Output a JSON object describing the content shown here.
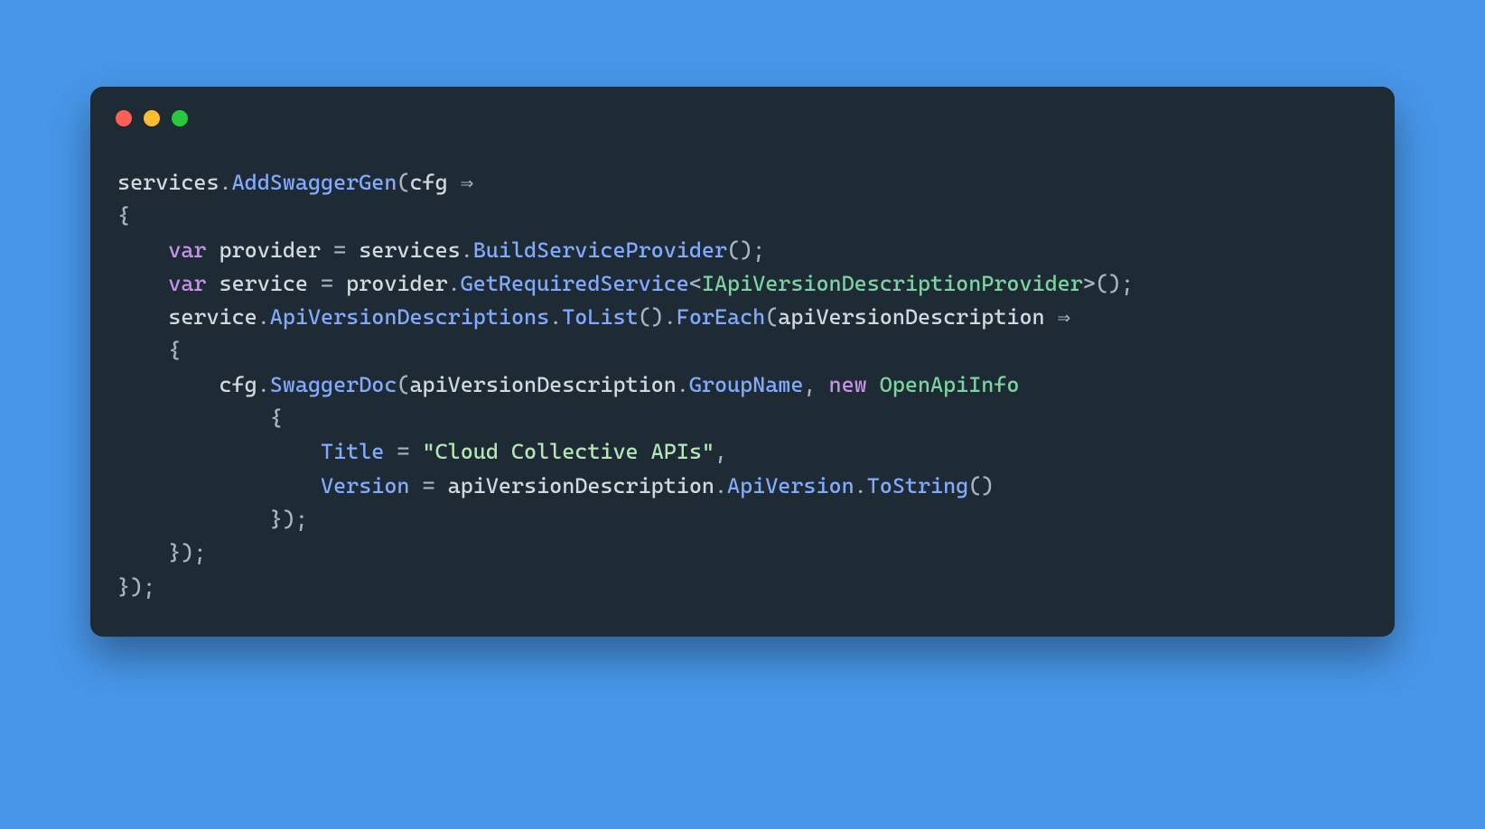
{
  "colors": {
    "background": "#4896e9",
    "card": "#1e2b34",
    "traffic_red": "#ff5f57",
    "traffic_yellow": "#febc2e",
    "traffic_green": "#28c840",
    "token_default": "#d2d9e1",
    "token_punct": "#a9b5c2",
    "token_method": "#82aaff",
    "token_type": "#7dd3a1",
    "token_keyword": "#c792ea",
    "token_string": "#b5e6b5"
  },
  "traffic_lights": [
    "red",
    "yellow",
    "green"
  ],
  "code": {
    "language": "csharp",
    "indent": "    ",
    "arrow": "⇒",
    "lines": [
      [
        {
          "cls": "tk-default",
          "t": "services"
        },
        {
          "cls": "tk-punct",
          "t": "."
        },
        {
          "cls": "tk-method",
          "t": "AddSwaggerGen"
        },
        {
          "cls": "tk-punct",
          "t": "("
        },
        {
          "cls": "tk-default",
          "t": "cfg "
        },
        {
          "cls": "tk-punct",
          "t": "⇒"
        }
      ],
      [
        {
          "cls": "tk-punct",
          "t": "{"
        }
      ],
      [
        {
          "cls": "tk-default",
          "t": "    "
        },
        {
          "cls": "tk-keyword",
          "t": "var"
        },
        {
          "cls": "tk-default",
          "t": " provider "
        },
        {
          "cls": "tk-punct",
          "t": "= "
        },
        {
          "cls": "tk-default",
          "t": "services"
        },
        {
          "cls": "tk-punct",
          "t": "."
        },
        {
          "cls": "tk-method",
          "t": "BuildServiceProvider"
        },
        {
          "cls": "tk-punct",
          "t": "();"
        }
      ],
      [
        {
          "cls": "tk-default",
          "t": "    "
        },
        {
          "cls": "tk-keyword",
          "t": "var"
        },
        {
          "cls": "tk-default",
          "t": " service "
        },
        {
          "cls": "tk-punct",
          "t": "= "
        },
        {
          "cls": "tk-default",
          "t": "provider"
        },
        {
          "cls": "tk-punct",
          "t": "."
        },
        {
          "cls": "tk-method",
          "t": "GetRequiredService"
        },
        {
          "cls": "tk-punct",
          "t": "<"
        },
        {
          "cls": "tk-type",
          "t": "IApiVersionDescriptionProvider"
        },
        {
          "cls": "tk-punct",
          "t": ">();"
        }
      ],
      [
        {
          "cls": "tk-default",
          "t": "    service"
        },
        {
          "cls": "tk-punct",
          "t": "."
        },
        {
          "cls": "tk-method",
          "t": "ApiVersionDescriptions"
        },
        {
          "cls": "tk-punct",
          "t": "."
        },
        {
          "cls": "tk-method",
          "t": "ToList"
        },
        {
          "cls": "tk-punct",
          "t": "()."
        },
        {
          "cls": "tk-method",
          "t": "ForEach"
        },
        {
          "cls": "tk-punct",
          "t": "("
        },
        {
          "cls": "tk-default",
          "t": "apiVersionDescription "
        },
        {
          "cls": "tk-punct",
          "t": "⇒"
        }
      ],
      [
        {
          "cls": "tk-default",
          "t": "    "
        },
        {
          "cls": "tk-punct",
          "t": "{"
        }
      ],
      [
        {
          "cls": "tk-default",
          "t": "        cfg"
        },
        {
          "cls": "tk-punct",
          "t": "."
        },
        {
          "cls": "tk-method",
          "t": "SwaggerDoc"
        },
        {
          "cls": "tk-punct",
          "t": "("
        },
        {
          "cls": "tk-default",
          "t": "apiVersionDescription"
        },
        {
          "cls": "tk-punct",
          "t": "."
        },
        {
          "cls": "tk-method",
          "t": "GroupName"
        },
        {
          "cls": "tk-punct",
          "t": ", "
        },
        {
          "cls": "tk-keyword",
          "t": "new"
        },
        {
          "cls": "tk-default",
          "t": " "
        },
        {
          "cls": "tk-type",
          "t": "OpenApiInfo"
        }
      ],
      [
        {
          "cls": "tk-default",
          "t": "            "
        },
        {
          "cls": "tk-punct",
          "t": "{"
        }
      ],
      [
        {
          "cls": "tk-default",
          "t": "                "
        },
        {
          "cls": "tk-method",
          "t": "Title"
        },
        {
          "cls": "tk-default",
          "t": " "
        },
        {
          "cls": "tk-punct",
          "t": "= "
        },
        {
          "cls": "tk-string",
          "t": "\"Cloud Collective APIs\""
        },
        {
          "cls": "tk-punct",
          "t": ","
        }
      ],
      [
        {
          "cls": "tk-default",
          "t": "                "
        },
        {
          "cls": "tk-method",
          "t": "Version"
        },
        {
          "cls": "tk-default",
          "t": " "
        },
        {
          "cls": "tk-punct",
          "t": "= "
        },
        {
          "cls": "tk-default",
          "t": "apiVersionDescription"
        },
        {
          "cls": "tk-punct",
          "t": "."
        },
        {
          "cls": "tk-method",
          "t": "ApiVersion"
        },
        {
          "cls": "tk-punct",
          "t": "."
        },
        {
          "cls": "tk-method",
          "t": "ToString"
        },
        {
          "cls": "tk-punct",
          "t": "()"
        }
      ],
      [
        {
          "cls": "tk-default",
          "t": "            "
        },
        {
          "cls": "tk-punct",
          "t": "});"
        }
      ],
      [
        {
          "cls": "tk-default",
          "t": "    "
        },
        {
          "cls": "tk-punct",
          "t": "});"
        }
      ],
      [
        {
          "cls": "tk-punct",
          "t": "});"
        }
      ]
    ]
  }
}
